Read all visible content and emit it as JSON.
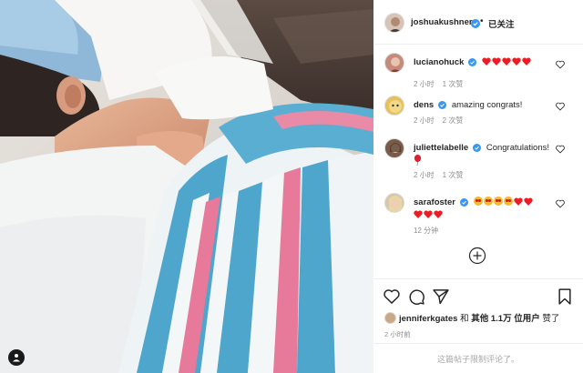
{
  "post": {
    "author": "joshuakushner",
    "separator": "•",
    "follow_label": "已关注"
  },
  "comments": [
    {
      "username": "lucianohuck",
      "text": "",
      "emoji": [
        "heart",
        "heart",
        "heart",
        "heart",
        "heart"
      ],
      "time": "2 小时",
      "likes": "1 次赞",
      "avatar_color": "#c58a7a"
    },
    {
      "username": "dens",
      "text": "amazing congrats!",
      "emoji": [],
      "time": "2 小时",
      "likes": "2 次赞",
      "avatar_color": "#e6c15a"
    },
    {
      "username": "juliettelabelle",
      "text": "Congratulations!",
      "emoji": [
        "balloon"
      ],
      "time": "2 小时",
      "likes": "1 次赞",
      "avatar_color": "#7a5a48"
    },
    {
      "username": "sarafoster",
      "text": "",
      "emoji": [
        "heart-eyes",
        "heart-eyes",
        "heart-eyes",
        "heart-eyes",
        "heart",
        "heart",
        "heart",
        "heart",
        "heart"
      ],
      "time": "12 分钟",
      "likes": "",
      "avatar_color": "#d9c7a8"
    }
  ],
  "likes_line": {
    "user": "jenniferkgates",
    "and": "和",
    "others": "其他 1.1万 位用户",
    "suffix": "赞了"
  },
  "timestamp": "2 小时前",
  "restricted_notice": "这篇帖子限制评论了。",
  "colors": {
    "verified": "#3897f0",
    "heart": "#ed1c24",
    "muted": "#8e8e8e"
  },
  "icons": [
    "verified-badge-icon",
    "heart-outline-icon",
    "comment-icon",
    "share-icon",
    "bookmark-icon",
    "plus-circle-icon",
    "user-tag-icon"
  ]
}
